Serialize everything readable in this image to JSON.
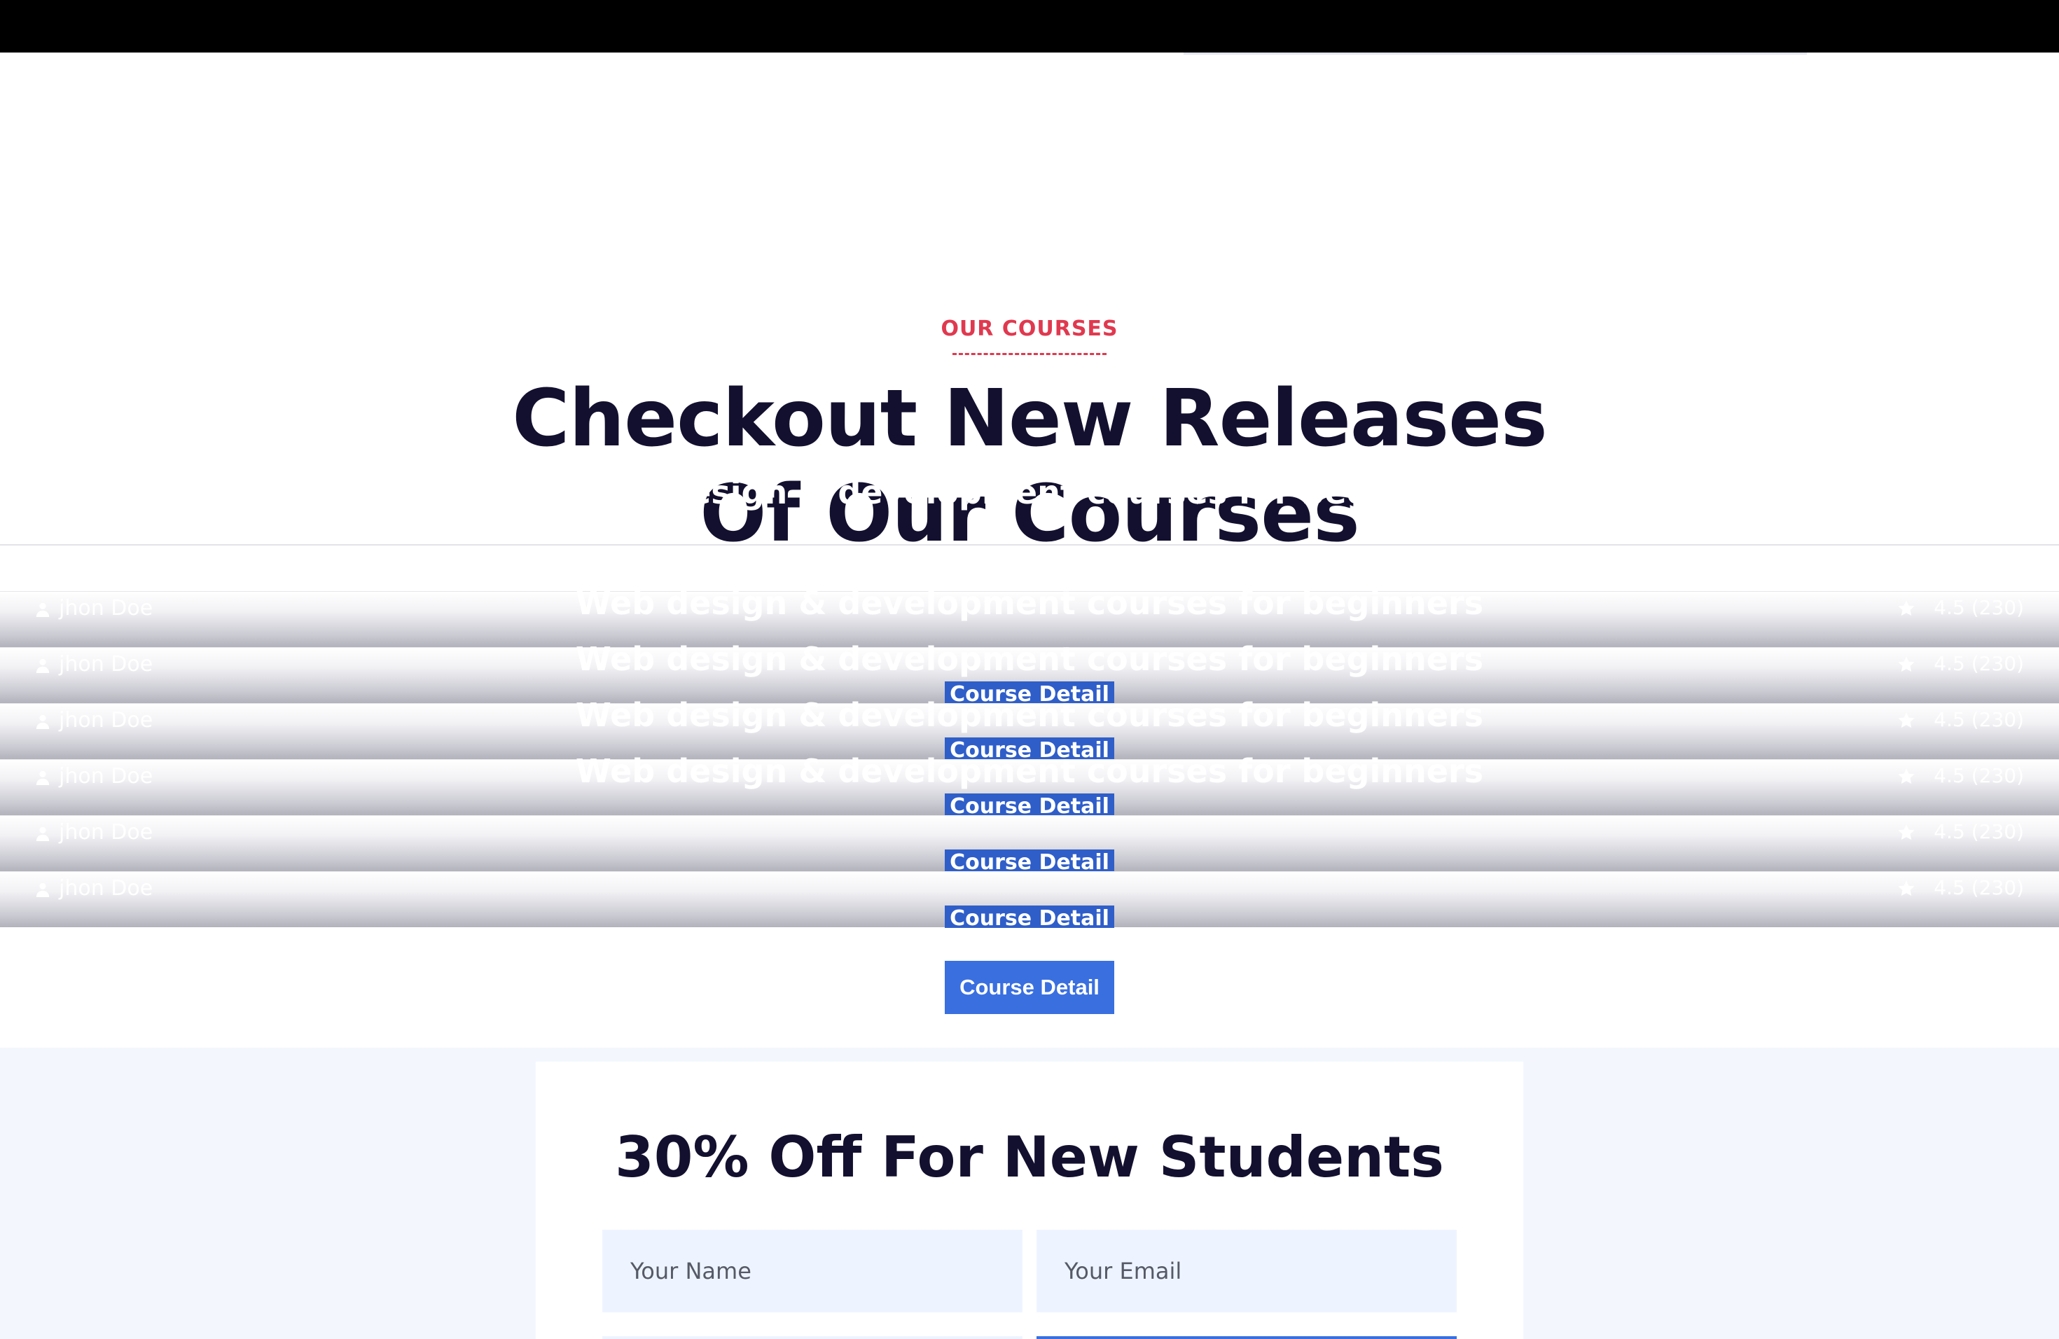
{
  "section": {
    "eyebrow": "OUR COURSES",
    "headline_line1": "Checkout New Releases",
    "headline_line2": "Of Our Courses"
  },
  "ghost_titles": [
    "Web design & development courses for beginners",
    "Web design & development courses for beginners",
    "Web design & development courses for beginners",
    "Web design & development courses for beginners",
    "Web design & development courses for beginners"
  ],
  "cards": [
    {
      "author": "jhon Doe",
      "rating": "4.5",
      "reviews": "(230)",
      "button": "Course Detail"
    },
    {
      "author": "jhon Doe",
      "rating": "4.5",
      "reviews": "(230)",
      "button": "Course Detail"
    },
    {
      "author": "jhon Doe",
      "rating": "4.5",
      "reviews": "(230)",
      "button": "Course Detail"
    },
    {
      "author": "jhon Doe",
      "rating": "4.5",
      "reviews": "(230)",
      "button": "Course Detail"
    },
    {
      "author": "jhon Doe",
      "rating": "4.5",
      "reviews": "(230)",
      "button": "Course Detail"
    },
    {
      "author": "jhon Doe",
      "rating": "4.5",
      "reviews": "(230)",
      "button": "Course Detail"
    }
  ],
  "cta_button": "Course Detail",
  "offer": {
    "title": "30% Off For New Students",
    "name_placeholder": "Your Name",
    "email_placeholder": "Your Email"
  },
  "colors": {
    "accent_red": "#e0394f",
    "heading": "#13102f",
    "button_blue": "#3a6fe0",
    "field_bg": "#eef4ff"
  },
  "icons": {
    "author": "person-icon",
    "rating": "star-icon"
  }
}
